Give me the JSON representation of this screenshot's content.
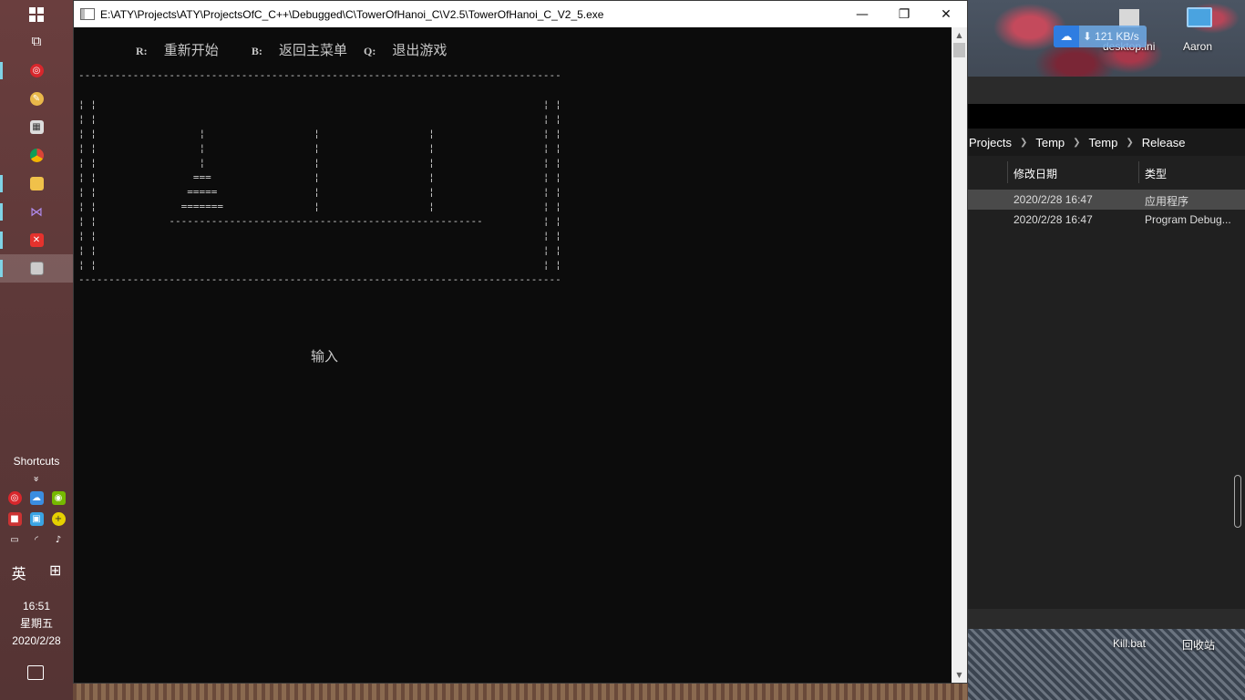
{
  "console": {
    "title": "E:\\ATY\\Projects\\ATY\\ProjectsOfC_C++\\Debugged\\C\\TowerOfHanoi_C\\V2.5\\TowerOfHanoi_C_V2_5.exe",
    "menu": [
      {
        "key": "R:",
        "label": "重新开始"
      },
      {
        "key": "B:",
        "label": "返回主菜单"
      },
      {
        "key": "Q:",
        "label": "退出游戏"
      }
    ],
    "ascii_art": "--------------------------------------------------------------------------------\n\n¦ ¦                                                                          ¦ ¦\n¦ ¦                                                                          ¦ ¦\n¦ ¦                 ¦                  ¦                  ¦                  ¦ ¦\n¦ ¦                 ¦                  ¦                  ¦                  ¦ ¦\n¦ ¦                 ¦                  ¦                  ¦                  ¦ ¦\n¦ ¦                ===                 ¦                  ¦                  ¦ ¦\n¦ ¦               =====                ¦                  ¦                  ¦ ¦\n¦ ¦              =======               ¦                  ¦                  ¦ ¦\n¦ ¦            ----------------------------------------------------          ¦ ¦\n¦ ¦                                                                          ¦ ¦\n¦ ¦                                                                          ¦ ¦\n¦ ¦                                                                          ¦ ¦\n--------------------------------------------------------------------------------",
    "prompt": "输入",
    "controls": {
      "minimize": "—",
      "restore": "❐",
      "close": "✕"
    }
  },
  "taskbar": {
    "shortcuts_title": "Shortcuts",
    "chevron": "»",
    "ime": [
      "英",
      "⊞"
    ],
    "time": "16:51",
    "weekday": "星期五",
    "date": "2020/2/28"
  },
  "explorer": {
    "breadcrumb": [
      "Projects",
      "Temp",
      "Temp",
      "Release"
    ],
    "columns": [
      "修改日期",
      "类型"
    ],
    "rows": [
      {
        "date": "2020/2/28 16:47",
        "type": "应用程序"
      },
      {
        "date": "2020/2/28 16:47",
        "type": "Program Debug..."
      }
    ]
  },
  "desktop": {
    "speed": "121 KB/s",
    "file_label": "desktop.ini",
    "user_label": "Aaron",
    "kill_label": "Kill.bat",
    "recycle_label": "回收站"
  },
  "colors": {
    "console_bg": "#0c0c0c",
    "console_text": "#c8c8c8",
    "taskbar": "#5c3838",
    "accent": "#7fd3e6"
  }
}
